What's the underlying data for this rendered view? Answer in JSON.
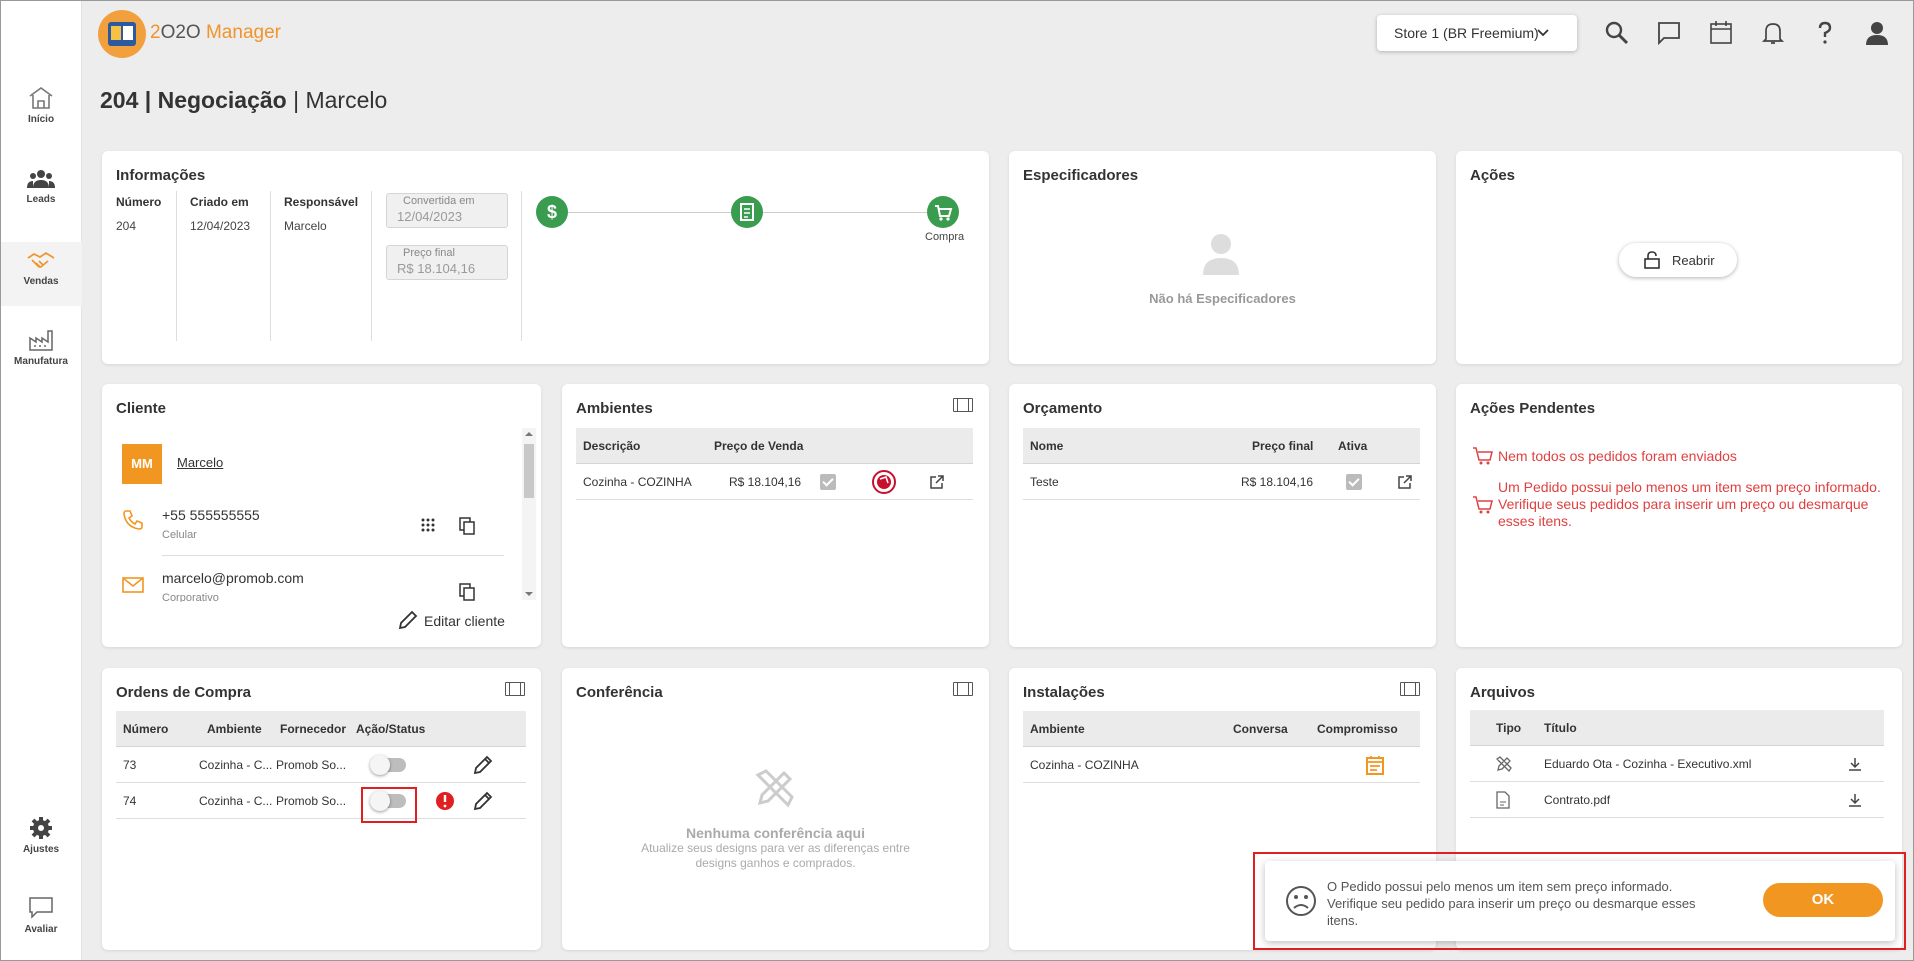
{
  "app": {
    "name_prefix": "2",
    "name_mid": "O2O",
    "name_suffix": " Manager"
  },
  "store_selector": {
    "label": "Store 1 (BR Freemium)"
  },
  "sidebar": {
    "items": [
      {
        "label": "Início"
      },
      {
        "label": "Leads"
      },
      {
        "label": "Vendas"
      },
      {
        "label": "Manufatura"
      },
      {
        "label": "Ajustes"
      },
      {
        "label": "Avaliar"
      }
    ]
  },
  "page": {
    "number_title": "204 | Negociação",
    "client_title": "| Marcelo"
  },
  "informacoes": {
    "title": "Informações",
    "numero_label": "Número",
    "numero_value": "204",
    "criado_label": "Criado em",
    "criado_value": "12/04/2023",
    "resp_label": "Responsável",
    "resp_value": "Marcelo",
    "convertida_label": "Convertida em",
    "convertida_value": "12/04/2023",
    "preco_label": "Preço final",
    "preco_value": "R$ 18.104,16",
    "step_compra_label": "Compra"
  },
  "especificadores": {
    "title": "Especificadores",
    "empty": "Não há Especificadores"
  },
  "acoes": {
    "title": "Ações",
    "reabrir": "Reabrir"
  },
  "cliente": {
    "title": "Cliente",
    "initials": "MM",
    "name": "Marcelo",
    "phone": "+55 555555555",
    "phone_type": "Celular",
    "email": "marcelo@promob.com",
    "email_type": "Corporativo",
    "edit": "Editar cliente"
  },
  "ambientes": {
    "title": "Ambientes",
    "headers": [
      "Descrição",
      "Preço de Venda"
    ],
    "rows": [
      {
        "descricao": "Cozinha - COZINHA",
        "preco": "R$ 18.104,16"
      }
    ]
  },
  "orcamento": {
    "title": "Orçamento",
    "headers": [
      "Nome",
      "Preço final",
      "Ativa"
    ],
    "rows": [
      {
        "nome": "Teste",
        "preco": "R$ 18.104,16"
      }
    ]
  },
  "pendentes": {
    "title": "Ações Pendentes",
    "items": [
      "Nem todos os pedidos foram enviados",
      "Um Pedido possui pelo menos um item sem preço informado.",
      "Verifique seus pedidos para inserir um preço ou desmarque",
      "esses itens."
    ]
  },
  "ordens": {
    "title": "Ordens de Compra",
    "headers": [
      "Número",
      "Ambiente",
      "Fornecedor",
      "Ação/Status"
    ],
    "rows": [
      {
        "numero": "73",
        "ambiente": "Cozinha - C...",
        "fornecedor": "Promob So..."
      },
      {
        "numero": "74",
        "ambiente": "Cozinha - C...",
        "fornecedor": "Promob So..."
      }
    ]
  },
  "conferencia": {
    "title": "Conferência",
    "empty": "Nenhuma conferência aqui",
    "desc1": "Atualize seus designs para ver as diferenças entre",
    "desc2": "designs ganhos e comprados."
  },
  "instalacoes": {
    "title": "Instalações",
    "headers": [
      "Ambiente",
      "Conversa",
      "Compromisso"
    ],
    "rows": [
      {
        "ambiente": "Cozinha - COZINHA"
      }
    ]
  },
  "arquivos": {
    "title": "Arquivos",
    "headers": [
      "Tipo",
      "Título"
    ],
    "rows": [
      {
        "titulo": "Eduardo Ota - Cozinha - Executivo.xml"
      },
      {
        "titulo": "Contrato.pdf"
      }
    ]
  },
  "modal": {
    "line1": "O Pedido possui pelo menos um item sem preço informado.",
    "line2": "Verifique seu pedido para inserir um preço ou desmarque esses",
    "line3": "itens.",
    "ok": "OK"
  },
  "colors": {
    "accent": "#f29622",
    "success": "#3a9c4e",
    "error": "#e04040"
  }
}
